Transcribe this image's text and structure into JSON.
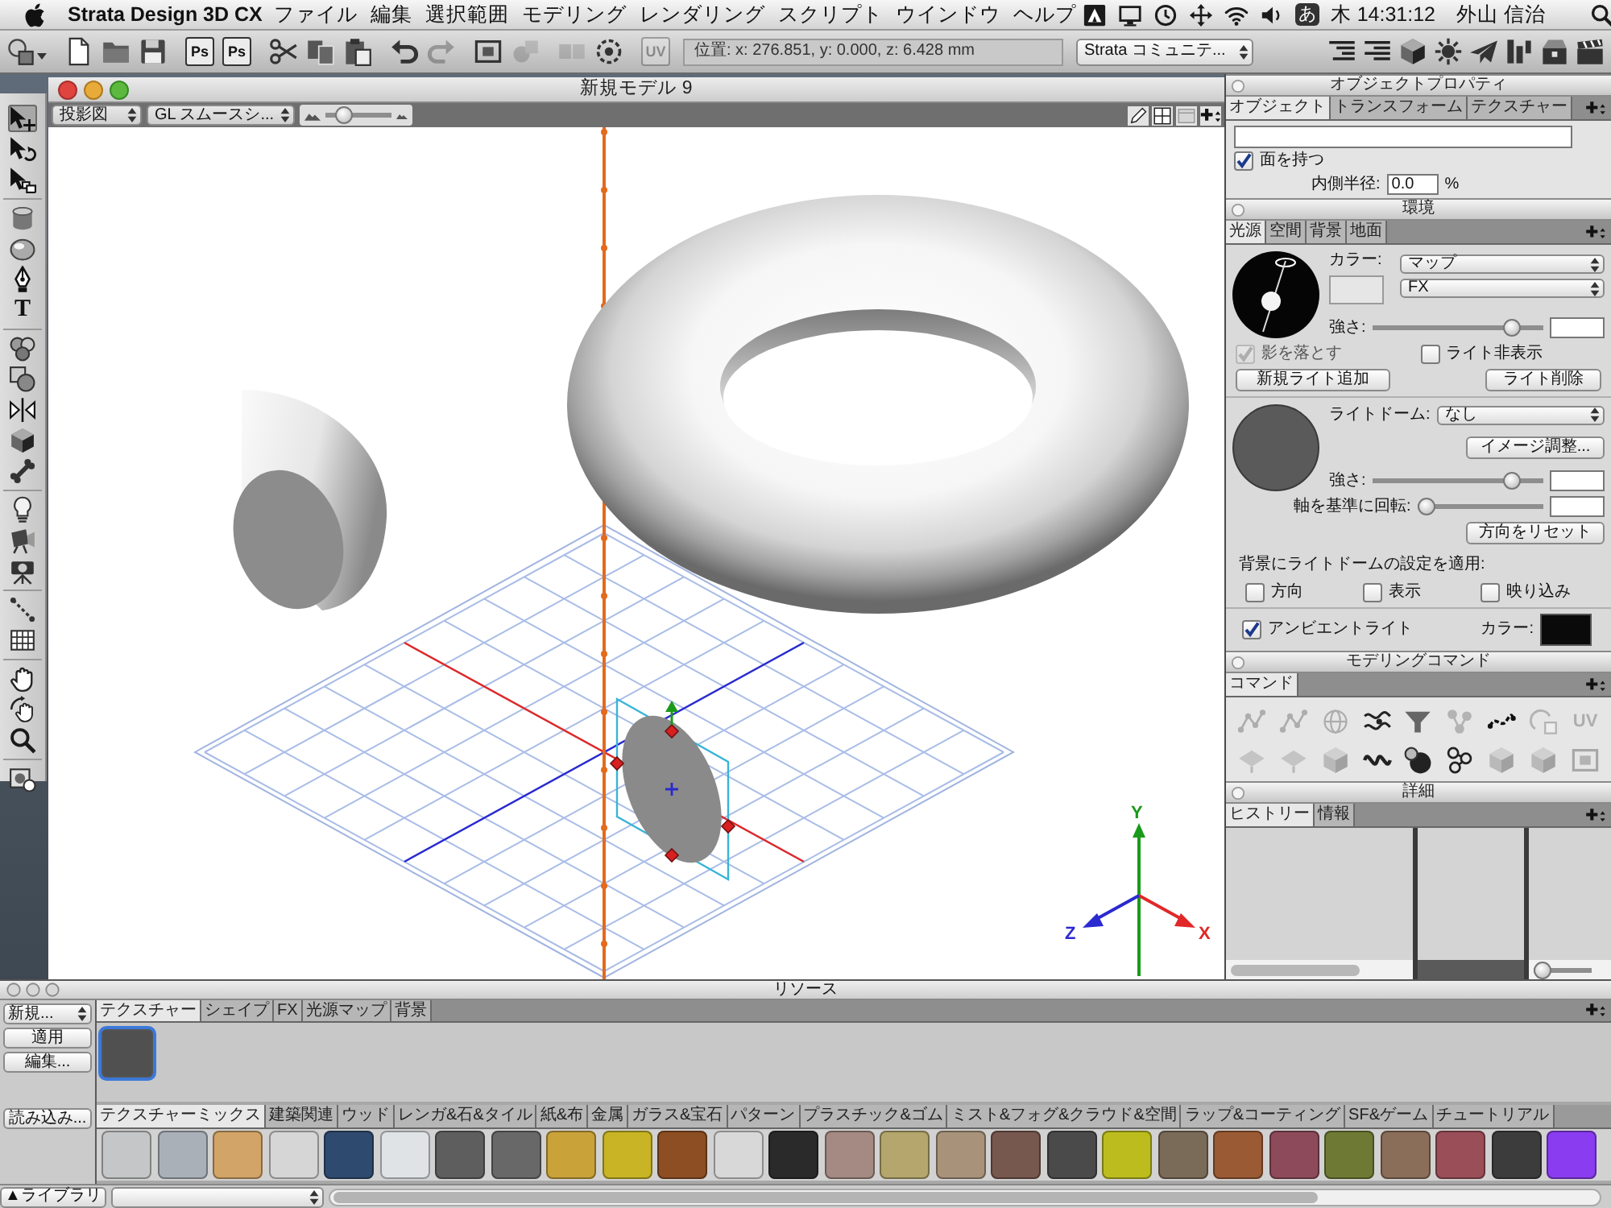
{
  "menu_bar": {
    "app_name": "Strata Design 3D CX",
    "menus": [
      "ファイル",
      "編集",
      "選択範囲",
      "モデリング",
      "レンダリング",
      "スクリプト",
      "ウインドウ",
      "ヘルプ"
    ],
    "input_mode": "あ",
    "clock": "木 14:31:12",
    "user": "外山 信治"
  },
  "toolbar": {
    "buttons": [
      {
        "disabled": false
      },
      {
        "disabled": false
      },
      {
        "disabled": false
      },
      {
        "disabled": false
      },
      {
        "label": "Ps",
        "disabled": false
      },
      {
        "label": "Ps",
        "disabled": false
      },
      {
        "disabled": false
      },
      {
        "disabled": false
      },
      {
        "disabled": false
      },
      {
        "disabled": false
      },
      {
        "disabled": true
      },
      {
        "disabled": false
      },
      {
        "disabled": true
      },
      {
        "disabled": true
      },
      {
        "disabled": false
      },
      {
        "label": "UV",
        "disabled": true
      }
    ],
    "position_readout": "位置: x: 276.851, y: 0.000, z: 6.428 mm",
    "community_dropdown": "Strata コミュニテ..."
  },
  "toolbox": {
    "tools": [
      {
        "selected": true
      },
      {
        "selected": false
      },
      {
        "selected": false
      },
      {
        "selected": false
      },
      {
        "selected": false
      },
      {
        "selected": false
      },
      {
        "selected": false,
        "glyph": "T"
      },
      {
        "selected": false
      },
      {
        "selected": false
      },
      {
        "selected": false
      },
      {
        "selected": false
      },
      {
        "selected": false
      },
      {
        "selected": false
      },
      {
        "selected": false
      },
      {
        "selected": false
      },
      {
        "selected": false
      },
      {
        "selected": false
      },
      {
        "selected": false
      },
      {
        "selected": false
      },
      {
        "selected": false
      },
      {
        "selected": false
      }
    ]
  },
  "viewport": {
    "title": "新規モデル 9",
    "projection_dropdown": "投影図",
    "render_dropdown": "GL スムースシ...",
    "zoom_slider": {
      "level": 0.2
    },
    "axis_labels": [
      "Y",
      "X",
      "Z"
    ]
  },
  "object_properties": {
    "title": "オブジェクトプロパティ",
    "tabs": [
      {
        "label": "オブジェクト",
        "selected": true
      },
      {
        "label": "トランスフォーム",
        "selected": false
      },
      {
        "label": "テクスチャー",
        "selected": false
      }
    ],
    "has_faces": {
      "label": "面を持つ",
      "checked": true
    },
    "inner_radius": {
      "label": "内側半径:",
      "value": "0.0",
      "unit": "%"
    }
  },
  "environment": {
    "title": "環境",
    "tabs": [
      {
        "label": "光源",
        "selected": true
      },
      {
        "label": "空間",
        "selected": false
      },
      {
        "label": "背景",
        "selected": false
      },
      {
        "label": "地面",
        "selected": false
      }
    ],
    "color_label": "カラー:",
    "map_dropdown": "マップ",
    "fx_dropdown": "FX",
    "intensity": {
      "label": "強さ:",
      "level": 0.85
    },
    "cast_shadow": {
      "label": "影を落とす",
      "checked": true,
      "disabled": true
    },
    "hide_light": {
      "label": "ライト非表示",
      "checked": false
    },
    "new_light_button": "新規ライト追加",
    "delete_light_button": "ライト削除",
    "light_dome": {
      "label": "ライトドーム:",
      "value": "なし"
    },
    "image_adjust_button": "イメージ調整...",
    "dome_intensity": {
      "label": "強さ:",
      "level": 0.85
    },
    "rotation": {
      "label": "軸を基準に回転:",
      "level": 0.0
    },
    "reset_direction_button": "方向をリセット",
    "apply_dome_label": "背景にライトドームの設定を適用:",
    "apply_options": [
      {
        "label": "方向",
        "checked": false
      },
      {
        "label": "表示",
        "checked": false
      },
      {
        "label": "映り込み",
        "checked": false
      }
    ],
    "ambient_light": {
      "label": "アンビエントライト",
      "checked": true
    },
    "ambient_color_label": "カラー:"
  },
  "modeling_commands": {
    "title": "モデリングコマンド",
    "tabs": [
      {
        "label": "コマンド",
        "selected": true
      }
    ],
    "commands": [
      {
        "disabled": true
      },
      {
        "disabled": true
      },
      {
        "disabled": true
      },
      {
        "disabled": false
      },
      {
        "disabled": false
      },
      {
        "disabled": true
      },
      {
        "disabled": false
      },
      {
        "disabled": true
      },
      {
        "label": "UV",
        "disabled": true
      },
      {
        "disabled": true
      },
      {
        "disabled": true
      },
      {
        "disabled": true
      },
      {
        "disabled": false
      },
      {
        "disabled": false
      },
      {
        "disabled": false
      },
      {
        "disabled": true
      },
      {
        "disabled": true
      },
      {
        "disabled": true
      }
    ]
  },
  "details": {
    "title": "詳細",
    "tabs": [
      {
        "label": "ヒストリー",
        "selected": true
      },
      {
        "label": "情報",
        "selected": false
      }
    ],
    "column_slider": {
      "level": 0.0
    }
  },
  "resources": {
    "title": "リソース",
    "new_button": "新規...",
    "apply_button": "適用",
    "edit_button": "編集...",
    "import_button": "読み込み...",
    "library_button": "▲ライブラリ",
    "tabs": [
      {
        "label": "テクスチャー",
        "selected": true
      },
      {
        "label": "シェイプ",
        "selected": false
      },
      {
        "label": "FX",
        "selected": false
      },
      {
        "label": "光源マップ",
        "selected": false
      },
      {
        "label": "背景",
        "selected": false
      }
    ],
    "items": [
      {
        "selected": true,
        "color": "#505050"
      }
    ],
    "library_tabs": [
      {
        "label": "テクスチャーミックス",
        "selected": true
      },
      {
        "label": "建築関連",
        "selected": false
      },
      {
        "label": "ウッド",
        "selected": false
      },
      {
        "label": "レンガ&石&タイル",
        "selected": false
      },
      {
        "label": "紙&布",
        "selected": false
      },
      {
        "label": "金属",
        "selected": false
      },
      {
        "label": "ガラス&宝石",
        "selected": false
      },
      {
        "label": "パターン",
        "selected": false
      },
      {
        "label": "プラスチック&ゴム",
        "selected": false
      },
      {
        "label": "ミスト&フォグ&クラウド&空間",
        "selected": false
      },
      {
        "label": "ラップ&コーティング",
        "selected": false
      },
      {
        "label": "SF&ゲーム",
        "selected": false
      },
      {
        "label": "チュートリアル",
        "selected": false
      }
    ],
    "library_items": [
      {
        "color": "#c4c6c8"
      },
      {
        "color": "#a9b0b8"
      },
      {
        "color": "#d2a468"
      },
      {
        "color": "#d6d6d6"
      },
      {
        "color": "#2e4a6e"
      },
      {
        "color": "#dfe3e6"
      },
      {
        "color": "#5e5e5e"
      },
      {
        "color": "#686868"
      },
      {
        "color": "#c9a23a"
      },
      {
        "color": "#c8b424"
      },
      {
        "color": "#8c4e22"
      },
      {
        "color": "#d8d8d8"
      },
      {
        "color": "#2a2a2a"
      },
      {
        "color": "#a48a82"
      },
      {
        "color": "#b4a66c"
      },
      {
        "color": "#a8927a"
      },
      {
        "color": "#76584e"
      },
      {
        "color": "#4a4a4a"
      },
      {
        "color": "#bcbc1e"
      },
      {
        "color": "#7a6a58"
      },
      {
        "color": "#9a5a34"
      },
      {
        "color": "#8c4a5a"
      },
      {
        "color": "#6e7a34"
      },
      {
        "color": "#8a6e5a"
      },
      {
        "color": "#9a4e58"
      },
      {
        "color": "#3c3c3c"
      },
      {
        "color": "#8a3cf0"
      }
    ]
  }
}
